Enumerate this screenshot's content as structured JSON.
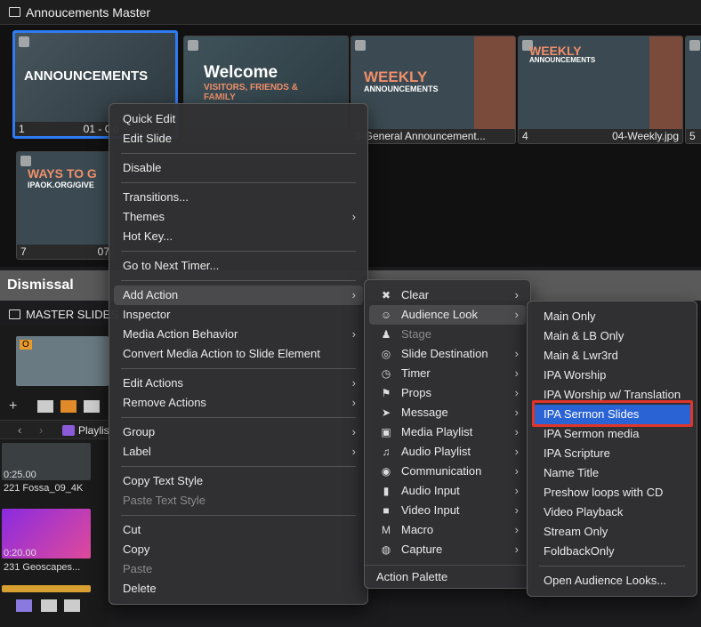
{
  "topbar": {
    "title": "Annoucements Master"
  },
  "slides": [
    {
      "number": "1",
      "name": "01 - Co",
      "headline": "ANNOUNCEMENTS"
    },
    {
      "number": "",
      "name": "",
      "headline": "Welcome",
      "sub": "VISITORS, FRIENDS & FAMILY"
    },
    {
      "number": "",
      "name": "3-General Announcement...",
      "headline": "WEEKLY",
      "sub": "ANNOUNCEMENTS"
    },
    {
      "number": "4",
      "name": "04-Weekly.jpg",
      "headline": "WEEKLY",
      "sub": "ANNOUNCEMENTS"
    },
    {
      "number": "5",
      "name": "0"
    },
    {
      "number": "7",
      "name": "07",
      "headline": "WAYS TO G",
      "sub": "IPAOK.ORG/GIVE"
    }
  ],
  "dismissal": "Dismissal",
  "master": {
    "label": "MASTER SLIDES",
    "badge": "O"
  },
  "playlist_label": "Playlis",
  "media": [
    {
      "time": "0:25.00",
      "name": "221 Fossa_09_4K"
    },
    {
      "time": "0:20.00",
      "name": "231 Geoscapes..."
    }
  ],
  "menu1": [
    {
      "label": "Quick Edit"
    },
    {
      "label": "Edit Slide"
    },
    {
      "sep": true
    },
    {
      "label": "Disable"
    },
    {
      "sep": true
    },
    {
      "label": "Transitions..."
    },
    {
      "label": "Themes",
      "arrow": true
    },
    {
      "label": "Hot Key..."
    },
    {
      "sep": true
    },
    {
      "label": "Go to Next Timer..."
    },
    {
      "sep": true
    },
    {
      "label": "Add Action",
      "arrow": true,
      "hl": true
    },
    {
      "label": "Inspector"
    },
    {
      "label": "Media Action Behavior",
      "arrow": true
    },
    {
      "label": "Convert Media Action to Slide Element"
    },
    {
      "sep": true
    },
    {
      "label": "Edit Actions",
      "arrow": true
    },
    {
      "label": "Remove Actions",
      "arrow": true
    },
    {
      "sep": true
    },
    {
      "label": "Group",
      "arrow": true
    },
    {
      "label": "Label",
      "arrow": true
    },
    {
      "sep": true
    },
    {
      "label": "Copy Text Style"
    },
    {
      "label": "Paste Text Style",
      "disabled": true
    },
    {
      "sep": true
    },
    {
      "label": "Cut"
    },
    {
      "label": "Copy"
    },
    {
      "label": "Paste",
      "disabled": true
    },
    {
      "label": "Delete"
    }
  ],
  "menu2": [
    {
      "label": "Clear",
      "icon": "✖",
      "arrow": true
    },
    {
      "label": "Audience Look",
      "icon": "☺",
      "arrow": true,
      "hl": true
    },
    {
      "label": "Stage",
      "icon": "♟",
      "disabled": true
    },
    {
      "label": "Slide Destination",
      "icon": "◎",
      "arrow": true
    },
    {
      "label": "Timer",
      "icon": "◷",
      "arrow": true
    },
    {
      "label": "Props",
      "icon": "⚑",
      "arrow": true
    },
    {
      "label": "Message",
      "icon": "➤",
      "arrow": true
    },
    {
      "label": "Media Playlist",
      "icon": "▣",
      "arrow": true
    },
    {
      "label": "Audio Playlist",
      "icon": "♫",
      "arrow": true
    },
    {
      "label": "Communication",
      "icon": "◉",
      "arrow": true
    },
    {
      "label": "Audio Input",
      "icon": "▮",
      "arrow": true
    },
    {
      "label": "Video Input",
      "icon": "■",
      "arrow": true
    },
    {
      "label": "Macro",
      "icon": "M",
      "arrow": true
    },
    {
      "label": "Capture",
      "icon": "◍",
      "arrow": true
    }
  ],
  "menu2_footer": "Action Palette",
  "menu3": [
    {
      "label": "Main Only"
    },
    {
      "label": "Main & LB Only"
    },
    {
      "label": "Main & Lwr3rd"
    },
    {
      "label": "IPA Worship"
    },
    {
      "label": "IPA Worship w/ Translation"
    },
    {
      "label": "IPA Sermon Slides",
      "selected": true
    },
    {
      "label": "IPA Sermon media"
    },
    {
      "label": "IPA Scripture"
    },
    {
      "label": "Name Title"
    },
    {
      "label": "Preshow loops with CD"
    },
    {
      "label": "Video Playback"
    },
    {
      "label": "Stream Only"
    },
    {
      "label": "FoldbackOnly"
    },
    {
      "sep": true
    },
    {
      "label": "Open Audience Looks..."
    }
  ]
}
